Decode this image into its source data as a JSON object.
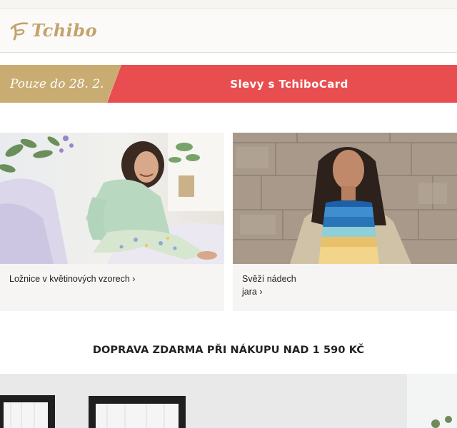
{
  "brand": {
    "name": "Tchibo"
  },
  "promo": {
    "left_text": "Pouze do 28. 2.",
    "right_text": "Slevy s TchiboCard",
    "colors": {
      "gold": "#c8ac72",
      "red": "#e84e50"
    }
  },
  "cards": [
    {
      "caption": "Ložnice v květinových vzorech ›",
      "image": "woman-in-floral-pajamas-photo"
    },
    {
      "caption": "Svěží nádech jara ›",
      "image": "woman-in-striped-sweater-photo"
    }
  ],
  "shipping": {
    "text": "DOPRAVA ZDARMA PŘI NÁKUPU NAD 1 590 KČ"
  },
  "hero": {
    "image": "house-facade-photo"
  }
}
